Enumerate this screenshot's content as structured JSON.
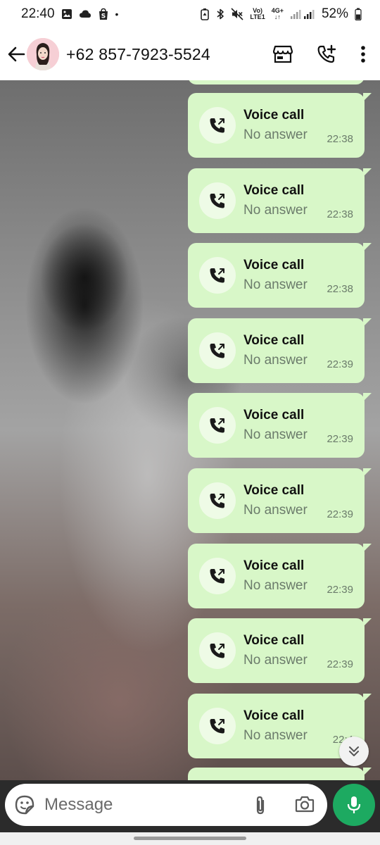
{
  "status_bar": {
    "time": "22:40",
    "dot": "•",
    "net_top": "Vo)",
    "net_bottom": "LTE1",
    "net2_top": "4G+",
    "net2_bottom": "↓↑",
    "battery": "52%",
    "icons": [
      "image-icon",
      "cloud-icon",
      "shop-icon",
      "data-saver-icon",
      "bluetooth-icon",
      "mute-icon",
      "signal-icon",
      "battery-icon"
    ]
  },
  "header": {
    "contact_name": "+62 857-7923-5524",
    "icons": [
      "back-arrow-icon",
      "store-icon",
      "add-call-icon",
      "more-vert-icon"
    ]
  },
  "messages": [
    {
      "title": "Voice call",
      "status": "No answer",
      "time": "22:38"
    },
    {
      "title": "Voice call",
      "status": "No answer",
      "time": "22:38"
    },
    {
      "title": "Voice call",
      "status": "No answer",
      "time": "22:38"
    },
    {
      "title": "Voice call",
      "status": "No answer",
      "time": "22:39"
    },
    {
      "title": "Voice call",
      "status": "No answer",
      "time": "22:39"
    },
    {
      "title": "Voice call",
      "status": "No answer",
      "time": "22:39"
    },
    {
      "title": "Voice call",
      "status": "No answer",
      "time": "22:39"
    },
    {
      "title": "Voice call",
      "status": "No answer",
      "time": "22:39"
    },
    {
      "title": "Voice call",
      "status": "No answer",
      "time": "22:4"
    }
  ],
  "input": {
    "placeholder": "Message"
  },
  "colors": {
    "bubble": "#d8f7c8",
    "accent_green": "#1daa61",
    "header_bg": "#ffffff"
  }
}
